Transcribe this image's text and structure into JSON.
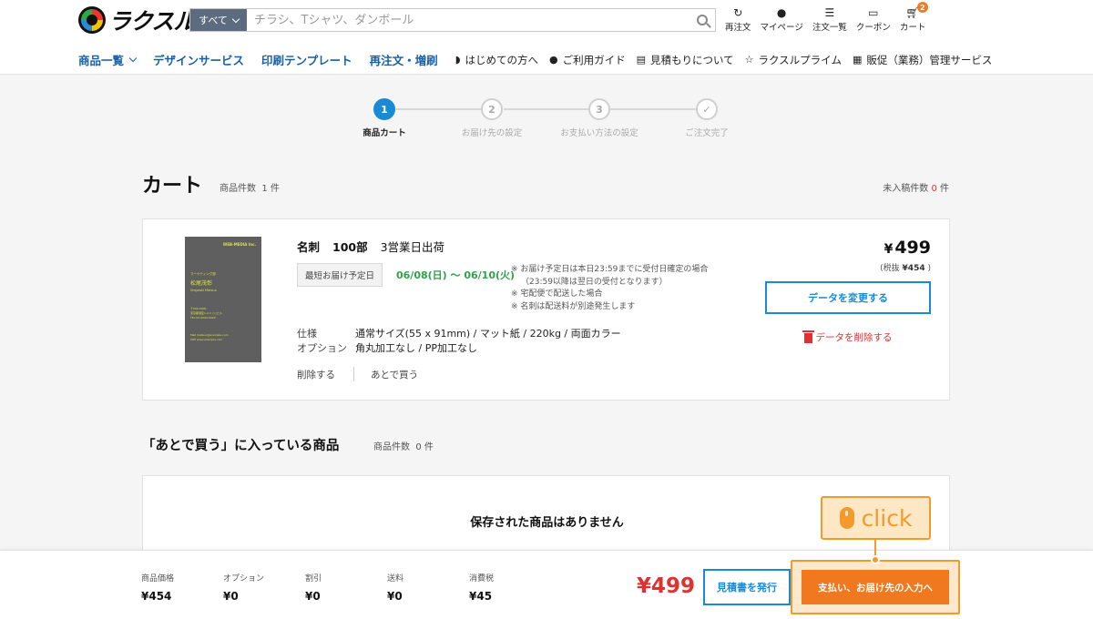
{
  "header": {
    "logo_text": "ラクスル",
    "search": {
      "category": "すべて",
      "placeholder": "チラシ、Tシャツ、ダンボール"
    },
    "icons": [
      {
        "label": "再注文",
        "icon": "refresh-icon"
      },
      {
        "label": "マイページ",
        "icon": "user-icon"
      },
      {
        "label": "注文一覧",
        "icon": "list-icon"
      },
      {
        "label": "クーポン",
        "icon": "coupon-icon"
      },
      {
        "label": "カート",
        "icon": "cart-icon",
        "badge": "2"
      }
    ],
    "nav_main": [
      "商品一覧",
      "デザインサービス",
      "印刷テンプレート",
      "再注文・増刷"
    ],
    "nav_sub": [
      "はじめての方へ",
      "ご利用ガイド",
      "見積もりについて",
      "ラクスルプライム",
      "販促（業務）管理サービス"
    ]
  },
  "stepper": {
    "steps": [
      {
        "num": "1",
        "label": "商品カート",
        "active": true
      },
      {
        "num": "2",
        "label": "お届け先の設定",
        "active": false
      },
      {
        "num": "3",
        "label": "お支払い方法の設定",
        "active": false
      },
      {
        "num": "✓",
        "label": "ご注文完了",
        "active": false
      }
    ]
  },
  "cart": {
    "title": "カート",
    "count_label": "商品件数",
    "count": "1",
    "count_unit": "件",
    "unposted_label": "未入稿件数",
    "unposted_count": "0",
    "unposted_unit": "件",
    "item": {
      "name": "名刺",
      "qty": "100部",
      "ship": "3営業日出荷",
      "delivery_label": "最短お届け予定日",
      "delivery_dates": "06/08(日) 〜 06/10(火)",
      "notes": [
        "※ お届け予定日は本日23:59までに受付日確定の場合",
        "（23:59以降は翌日の受付となります）",
        "※ 宅配便で配送した場合",
        "※ 名刺は配送料が別途発生します"
      ],
      "spec_label": "仕様",
      "spec_value": "通常サイズ(55 x 91mm) / マット紙 / 220kg / 両面カラー",
      "option_label": "オプション",
      "option_value": "角丸加工なし / PP加工なし",
      "delete_label": "削除する",
      "later_label": "あとで買う",
      "price_symbol": "¥",
      "price": "499",
      "tax_prefix": "(税抜",
      "tax_excl": "¥454",
      "tax_suffix": ")",
      "change_data_label": "データを変更する",
      "delete_data_label": "データを削除する",
      "thumb": {
        "brand": "WEB-MEDIA Inc.",
        "role": "マーケティング部",
        "name_jp": "松尾茂彰",
        "name_en": "Shigeaki Matsuo",
        "addr": [
          "〒000-0000",
          "東京都港区1-2-3 ○○ビル",
          "TEL 03-0000-0000"
        ],
        "contact": [
          "Mail matsuo@example.com",
          "URP www.example.com"
        ]
      }
    }
  },
  "later": {
    "title": "「あとで買う」に入っている商品",
    "count_label": "商品件数",
    "count": "0",
    "count_unit": "件",
    "empty_text": "保存された商品はありません"
  },
  "summary": {
    "items": [
      {
        "label": "商品価格",
        "value": "¥454"
      },
      {
        "label": "オプション",
        "value": "¥0"
      },
      {
        "label": "割引",
        "value": "¥0"
      },
      {
        "label": "送料",
        "value": "¥0"
      },
      {
        "label": "消費税",
        "value": "¥45"
      }
    ],
    "total": "¥499",
    "quote_button": "見積書を発行",
    "pay_button": "支払い、お届け先の入力へ"
  },
  "annotation": {
    "text": "click",
    "color": "#f39a2c"
  },
  "colors": {
    "accent_blue": "#1a8ad6",
    "price_red": "#e03131",
    "cta_orange": "#f0781e",
    "green": "#2fa24a"
  }
}
